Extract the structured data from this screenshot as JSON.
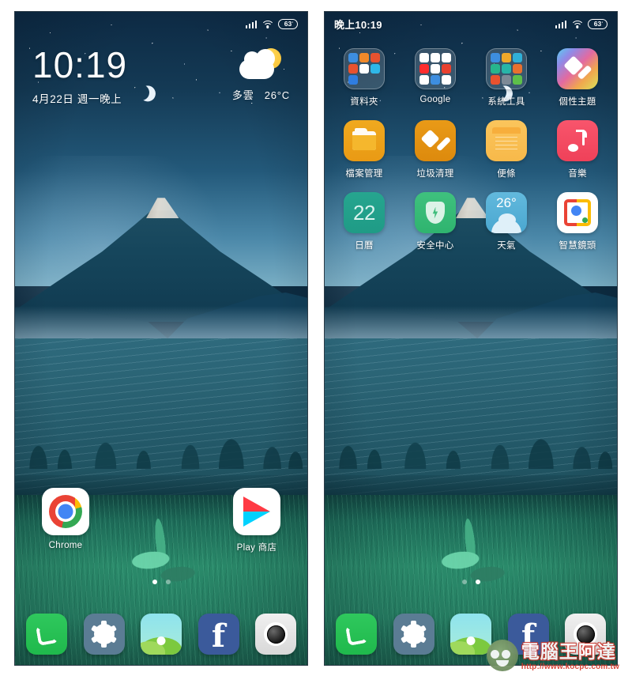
{
  "meta": {
    "layout": "two phone screenshots side by side on white background",
    "accent_colors": {
      "wallpaper_sky": "#143a55",
      "wallpaper_grass": "#2a8a6a",
      "folder_tint": "rgba(255,255,255,0.16)",
      "watermark_red": "#d83a2c"
    }
  },
  "left_screen": {
    "status_bar": {
      "time": "",
      "signal_icon": "signal-bars-icon",
      "wifi_icon": "wifi-icon",
      "battery_level": "63"
    },
    "clock_widget": {
      "time": "10:19",
      "date": "4月22日 週一晚上"
    },
    "weather_widget": {
      "icon": "partly-cloudy-icon",
      "condition": "多雲",
      "temperature": "26°C"
    },
    "home_icons": [
      {
        "label": "Chrome",
        "icon": "chrome-icon"
      },
      {
        "label": "Play 商店",
        "icon": "play-store-icon"
      }
    ],
    "page_dots": {
      "count": 2,
      "active_index": 0
    }
  },
  "right_screen": {
    "status_bar": {
      "time": "晚上10:19",
      "signal_icon": "signal-bars-icon",
      "wifi_icon": "wifi-icon",
      "battery_level": "63"
    },
    "app_rows": [
      [
        {
          "label": "資料夾",
          "icon": "folder-icon",
          "type": "folder",
          "mini_colors": [
            "#3d8ee0",
            "#f0892a",
            "#e8522f",
            "#e8522f",
            "#ffffff",
            "#2fb7e8",
            "#2f7de0",
            "",
            ""
          ]
        },
        {
          "label": "Google",
          "icon": "google-folder-icon",
          "type": "folder",
          "mini_colors": [
            "#ffffff",
            "#ffffff",
            "#ffffff",
            "#ff2d2d",
            "#ffffff",
            "#e8412f",
            "#ffffff",
            "#3d8ee0",
            "#ffffff"
          ]
        },
        {
          "label": "系統工具",
          "icon": "system-tools-folder-icon",
          "type": "folder",
          "mini_colors": [
            "#3d8ee0",
            "#f0a92a",
            "#2fb0d8",
            "#27b58c",
            "#27b5a8",
            "#e8702f",
            "#e8522f",
            "#7d8a96",
            "#5dbf4a"
          ]
        },
        {
          "label": "個性主題",
          "icon": "themes-icon",
          "type": "theme"
        }
      ],
      [
        {
          "label": "檔案管理",
          "icon": "file-manager-icon",
          "type": "files"
        },
        {
          "label": "垃圾清理",
          "icon": "cleaner-icon",
          "type": "clean"
        },
        {
          "label": "便條",
          "icon": "notes-icon",
          "type": "notes"
        },
        {
          "label": "音樂",
          "icon": "music-icon",
          "type": "music"
        }
      ],
      [
        {
          "label": "日曆",
          "icon": "calendar-icon",
          "type": "cal",
          "value": "22"
        },
        {
          "label": "安全中心",
          "icon": "security-icon",
          "type": "sec"
        },
        {
          "label": "天氣",
          "icon": "weather-icon",
          "type": "weather",
          "value": "26°"
        },
        {
          "label": "智慧鏡頭",
          "icon": "google-lens-icon",
          "type": "lens"
        }
      ]
    ],
    "page_dots": {
      "count": 2,
      "active_index": 1
    }
  },
  "dock": [
    {
      "label": "phone",
      "icon": "phone-icon"
    },
    {
      "label": "settings",
      "icon": "gear-icon"
    },
    {
      "label": "gallery",
      "icon": "gallery-icon"
    },
    {
      "label": "facebook",
      "icon": "facebook-icon",
      "glyph": "f"
    },
    {
      "label": "camera",
      "icon": "camera-icon"
    }
  ],
  "watermark": {
    "site_name": "電腦王阿達",
    "url": "http://www.kocpc.com.tw"
  }
}
